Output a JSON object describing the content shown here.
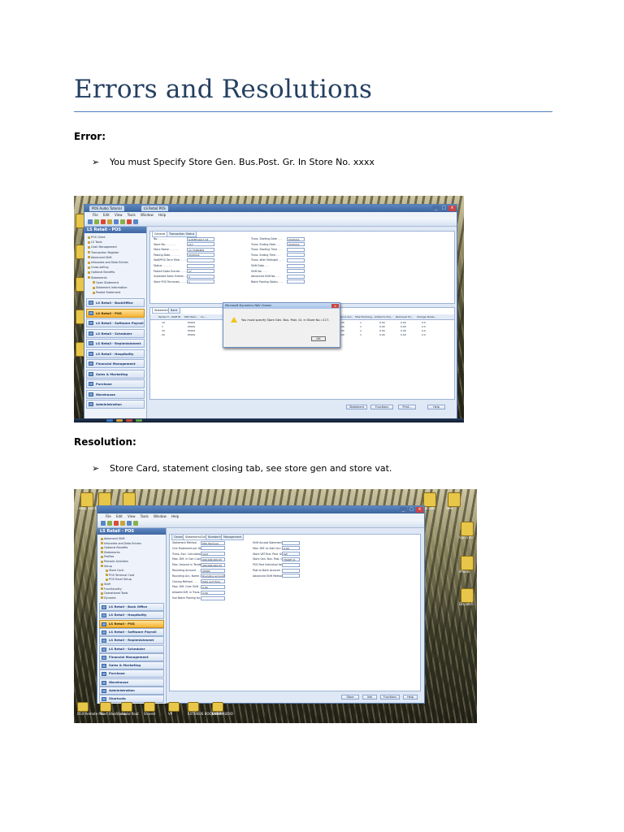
{
  "page": {
    "title": "Errors and Resolutions",
    "error_label": "Error:",
    "error_bullet": "You must Specify Store Gen. Bus.Post. Gr. In Store No. xxxx",
    "resolution_label": "Resolution:",
    "resolution_bullet": "Store Card, statement closing tab, see store gen and store vat.",
    "bullet_glyph": "➢"
  },
  "shot1": {
    "tab1": "POS Audio Tutorial",
    "tab2": "LS Retail POS",
    "menu": [
      "File",
      "Edit",
      "View",
      "Tools",
      "Window",
      "Help"
    ],
    "nav_title": "LS Retail - POS",
    "tree": [
      "POS Client",
      "LS Tools",
      "Cash Management",
      "Transaction Register",
      "Advanced Shift",
      "Infocodes and Data Entries",
      "Cross-selling",
      "Optional Benefits",
      "Statements",
      "Open Statement",
      "Statement Information",
      "Posted Statement"
    ],
    "modules": [
      "LS Retail - BackOffice",
      "LS Retail - POS",
      "LS Retail - Software Payroll",
      "LS Retail - Scheduler",
      "LS Retail - Replenishment",
      "LS Retail - Hospitality",
      "Financial Management",
      "Sales & Marketing",
      "Purchase",
      "Warehouse",
      "Administration"
    ],
    "active_module_index": 1,
    "card_tabs": [
      "General",
      "Transaction Status"
    ],
    "left_fields": [
      "No.",
      "Store No.",
      "Store Name",
      "Posting Date",
      "Staff/POS Term Filter",
      "Status",
      "Posted Sales Entries",
      "Unposted Sales Entries",
      "Store POS Terminals"
    ],
    "left_values": [
      "S-STMT-0117-01",
      "117",
      "Ali_FAIRVIEW",
      "03/03/14",
      "",
      "",
      "17",
      "0",
      "1"
    ],
    "right_fields": [
      "Trans. Starting Date",
      "Trans. Ending Date",
      "Trans. Starting Time",
      "Trans. Ending Time",
      "Trans. after Midnight",
      "Shift Date",
      "Shift No.",
      "Advanced Shift No.",
      "Batch Posting Status"
    ],
    "right_values": [
      "03/03/14",
      "03/03/14",
      "",
      "",
      "",
      "",
      "",
      "",
      ""
    ],
    "lines_tabs": [
      "Statement",
      "Bank"
    ],
    "grid_headers": [
      "Tender T...",
      "Staff ID",
      "POS Term...",
      "Cu..."
    ],
    "grid_rows": [
      [
        "10",
        "",
        "P0001",
        ""
      ],
      [
        "1",
        "",
        "P0001",
        ""
      ],
      [
        "10",
        "",
        "P0001",
        ""
      ],
      [
        "20",
        "",
        "P0001",
        ""
      ]
    ],
    "grid_headers_right": [
      "Difference Am...",
      "Total Exchang...",
      "Added to Dra...",
      "Removed fro...",
      "Change Tende..."
    ],
    "grid_rows_right": [
      [
        "0.00",
        "1",
        "0.00",
        "0.00",
        "0.0"
      ],
      [
        "0.00",
        "1",
        "0.00",
        "0.00",
        "0.0"
      ],
      [
        "0.00",
        "1",
        "0.00",
        "0.00",
        "0.0"
      ],
      [
        "0.00",
        "1",
        "0.00",
        "0.00",
        "0.0"
      ]
    ],
    "bottom_buttons": [
      "Statement",
      "Functions",
      "Print...",
      "Help"
    ],
    "dialog_title": "Microsoft Dynamics NAV Classic",
    "dialog_message": "You must specify Store Gen. Bus. Post. Gr. in Store No.=117.",
    "dialog_ok": "OK"
  },
  "shot2": {
    "desk_left": [
      "ebay 2014",
      "NEED TO",
      "Intel"
    ],
    "desk_right": [
      "bus sale",
      "new",
      "Vpn info",
      "iPhone",
      "Dispatch"
    ],
    "taskbar_items": [
      "OSX Remote Pro",
      "Start BlueStacks",
      "Audio Rout",
      "Shared",
      "VP",
      "EXTENSIS BOOKMARK",
      "ENEM AUDIO"
    ],
    "nav_title": "LS Retail - POS",
    "tree": [
      "Advanced Shift",
      "Infocodes and Data Entries",
      "Optional Benefits",
      "Statements",
      "Profiles",
      "Periodic Activities",
      "Setup",
      "Store Card",
      "POS Terminal Card",
      "POS Excel Setup",
      "Staff",
      "Functionality",
      "Operational Tools",
      "Dynamic"
    ],
    "modules": [
      "LS Retail - Back Office",
      "LS Retail - Hospitality",
      "LS Retail - POS",
      "LS Retail - Software Payroll",
      "LS Retail - Replenishment",
      "LS Retail - Scheduler",
      "Financial Management",
      "Sales & Marketing",
      "Purchase",
      "Warehouse",
      "Administration",
      "Shortcuts"
    ],
    "active_module_index": 2,
    "card_tabs": [
      "General",
      "Statement/Closing",
      "Numbering",
      "Management"
    ],
    "left_fields": [
      "Statement Method",
      "One Statement per Day",
      "Trans. Excl. Calculation",
      "Max. Diff. in Gen Cust.",
      "Max. Amount in Tender",
      "Rounding Account",
      "Rounding Acc. Name",
      "Closing Method",
      "Max. Diff. Over Shift",
      "Allowed Diff. in Trans.",
      "Use Batch Posting for..."
    ],
    "left_values": [
      "POS Terminal",
      "",
      "Card",
      "999,999,999.00",
      "999,999,999.00",
      "99990",
      "Rounding account",
      "Date and Time",
      "0.00",
      "0.00",
      ""
    ],
    "right_fields": [
      "Shift Accept Statement",
      "Max. Diff. to Alert Acc.",
      "Store VAT Bus. Post. Gr.",
      "Store Gen. Bus. Post. Gr.",
      "POS Post Individual Item",
      "Post to Bank Account",
      "Advanced Shift Method"
    ],
    "right_values": [
      "",
      "0.00",
      "SLT",
      "TRADE 11",
      "",
      "",
      ""
    ],
    "bottom_buttons": [
      "Store",
      "Info",
      "Functions",
      "Help"
    ]
  }
}
